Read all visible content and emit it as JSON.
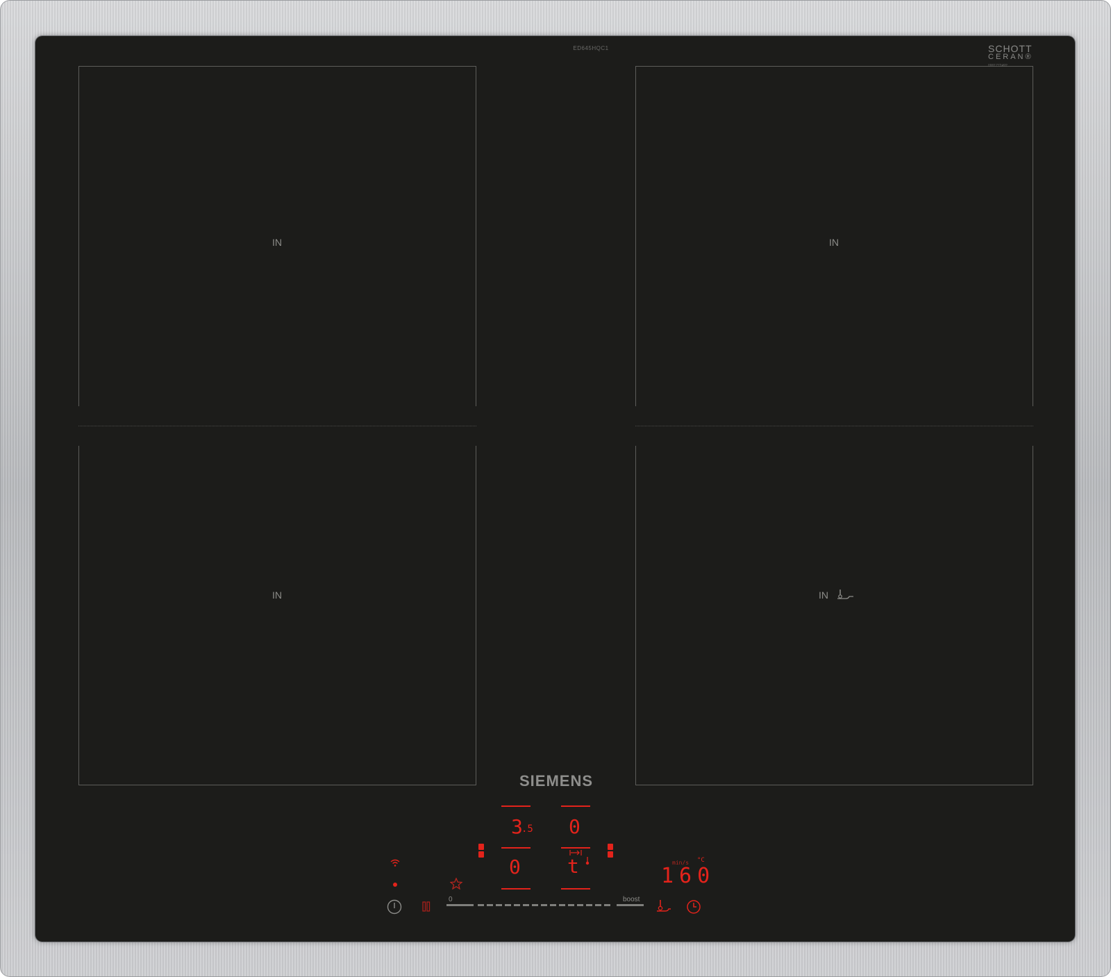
{
  "appliance": {
    "model_number": "ED645HQC1",
    "glass_brand_line1": "SCHOTT",
    "glass_brand_line2": "CERAN®",
    "glass_serial": "0001772492",
    "brand": "SIEMENS"
  },
  "zones": {
    "front_left_label": "IN",
    "rear_left_label": "IN",
    "front_right_label": "IN",
    "rear_right_label": "IN"
  },
  "display": {
    "rear_left_level": "3",
    "rear_left_level_fraction": ".5",
    "rear_right_level": "0",
    "front_left_level": "0",
    "front_right_level": "t",
    "frying_unit": "°C",
    "frying_label": "min/s",
    "temperature_value": "160"
  },
  "controls": {
    "slider_min_label": "0",
    "slider_max_label": "boost"
  },
  "icons": {
    "wifi": "wifi-icon",
    "power": "power-icon",
    "pause": "pause-icon",
    "favourite": "star-icon",
    "frying_sensor": "frying-sensor-icon",
    "timer": "clock-icon"
  },
  "colors": {
    "glass": "#1c1c1a",
    "indicator_red": "#e3231b",
    "printing_grey": "#8c8c89"
  }
}
